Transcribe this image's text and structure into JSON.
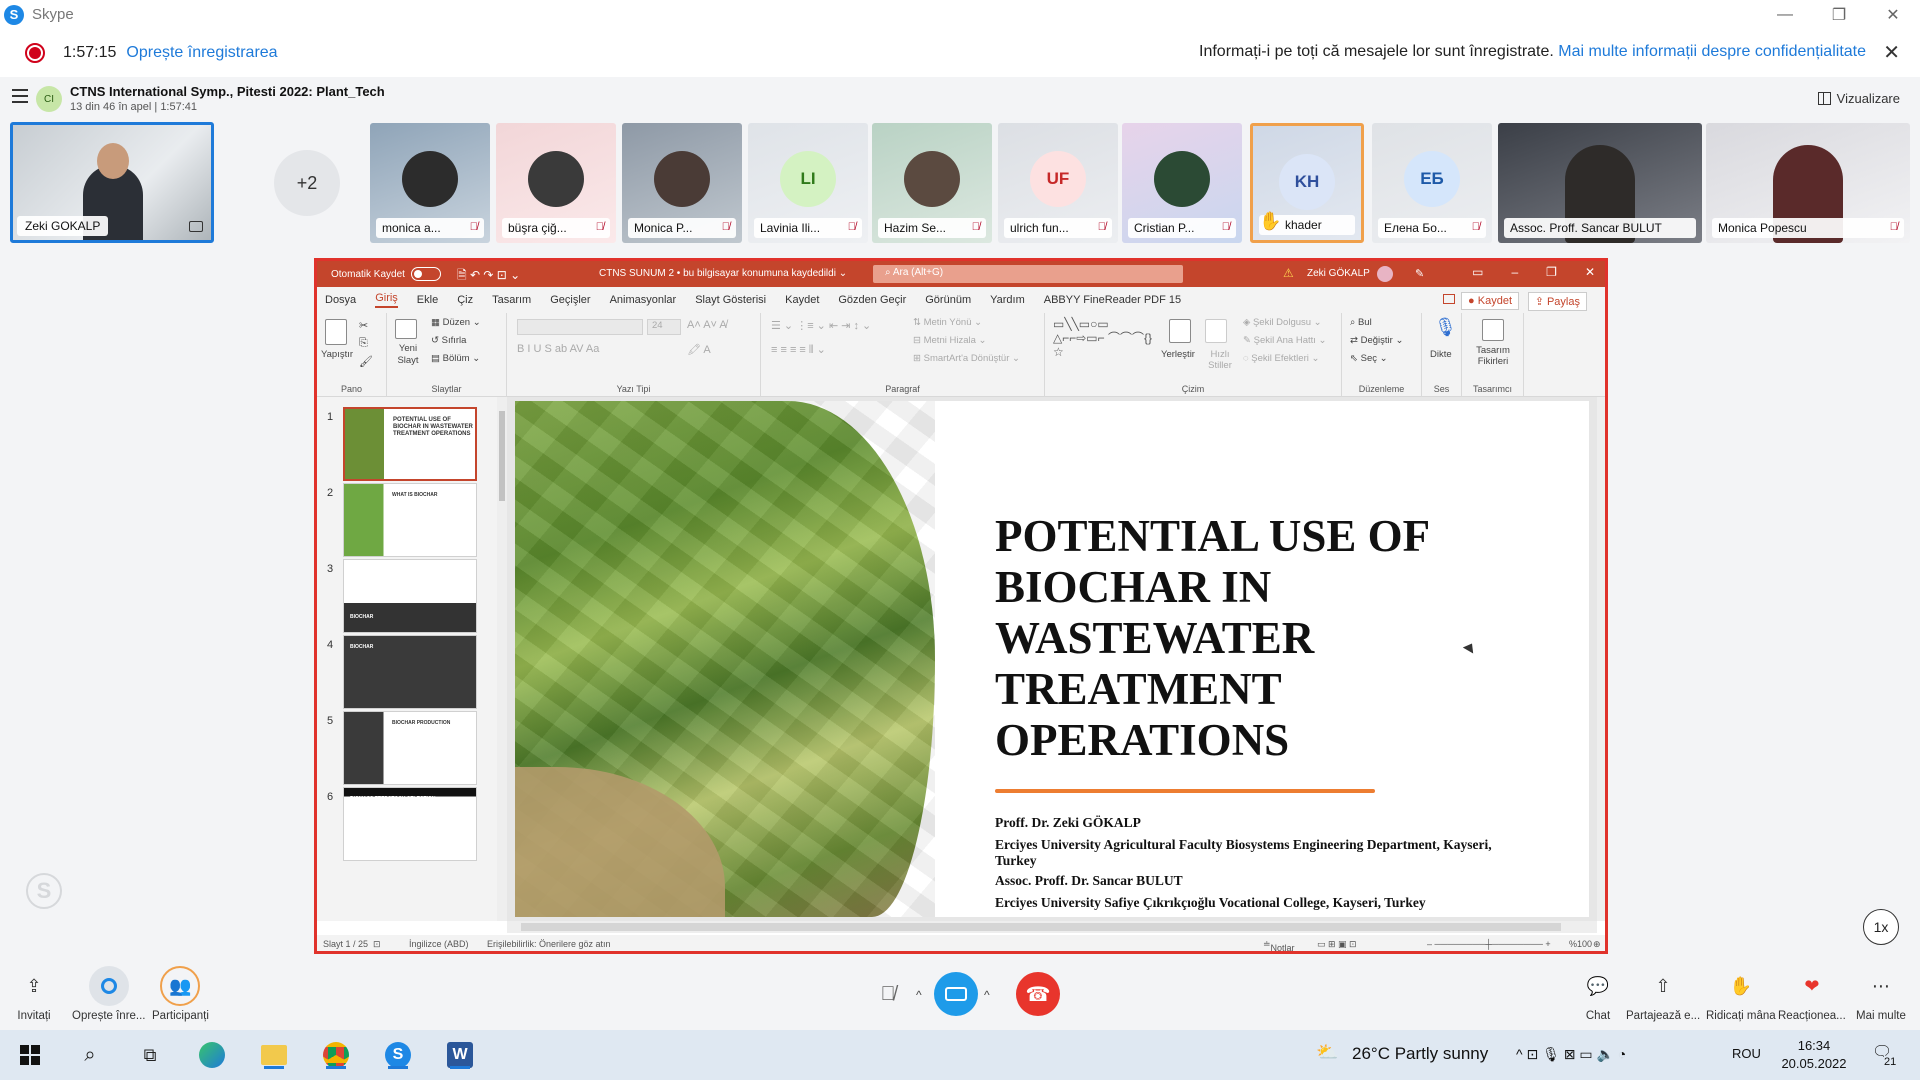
{
  "window": {
    "title": "Skype",
    "minimize": "—",
    "restore": "❐",
    "close": "✕"
  },
  "recording": {
    "time": "1:57:15",
    "stop_label": "Oprește înregistrarea",
    "notice": "Informați-i pe toți că mesajele lor sunt înregistrate.",
    "privacy_link": "Mai multe informații despre confidențialitate"
  },
  "call": {
    "group_initials": "CI",
    "title": "CTNS International Symp., Pitesti 2022: Plant_Tech",
    "subtitle": "13 din 46 în apel | 1:57:41",
    "layout_label": "Vizualizare"
  },
  "self_tile": {
    "name": "Zeki GOKALP"
  },
  "more_participants": "+2",
  "participants": [
    {
      "name": "monica a...",
      "initials": "",
      "muted": true
    },
    {
      "name": "büşra çiğ...",
      "initials": "",
      "muted": true
    },
    {
      "name": "Monica P...",
      "initials": "",
      "muted": true
    },
    {
      "name": "Lavinia Ili...",
      "initials": "LI",
      "muted": true
    },
    {
      "name": "Hazim Se...",
      "initials": "",
      "muted": true
    },
    {
      "name": "ulrich fun...",
      "initials": "UF",
      "muted": true
    },
    {
      "name": "Cristian P...",
      "initials": "",
      "muted": true
    },
    {
      "name": "khader",
      "initials": "KH",
      "muted": false,
      "hand": "✋"
    },
    {
      "name": "Елена Бо...",
      "initials": "ЕБ",
      "muted": true
    },
    {
      "name": "Assoc. Proff. Sancar BULUT",
      "initials": "",
      "muted": false
    },
    {
      "name": "Monica Popescu",
      "initials": "",
      "muted": true
    }
  ],
  "ppt": {
    "autosave": "Otomatik Kaydet",
    "doc_title": "CTNS SUNUM 2 • bu bilgisayar konumuna kaydedildi ⌄",
    "search_placeholder": "Ara (Alt+G)",
    "user": "Zeki GÖKALP",
    "tabs": [
      "Dosya",
      "Giriş",
      "Ekle",
      "Çiz",
      "Tasarım",
      "Geçişler",
      "Animasyonlar",
      "Slayt Gösterisi",
      "Kaydet",
      "Gözden Geçir",
      "Görünüm",
      "Yardım",
      "ABBYY FineReader PDF 15"
    ],
    "save_btn": "Kaydet",
    "share_btn": "Paylaş",
    "ribbon": {
      "pano": "Pano",
      "yapistir": "Yapıştır",
      "yeni_slayt": "Yeni Slayt",
      "duzen": "Düzen",
      "sifirla": "Sıfırla",
      "bolum": "Bölüm",
      "slaytlar": "Slaytlar",
      "yazi_tipi": "Yazı Tipi",
      "font_size": "24",
      "paragraf": "Paragraf",
      "metin_yonu": "Metin Yönü",
      "metni_hizala": "Metni Hizala",
      "smartart": "SmartArt'a Dönüştür",
      "cizim": "Çizim",
      "yerlestir": "Yerleştir",
      "hizli_stiller": "Hızlı Stiller",
      "sekil_dolgusu": "Şekil Dolgusu",
      "sekil_ana_hatti": "Şekil Ana Hattı",
      "sekil_efektleri": "Şekil Efektleri",
      "bul": "Bul",
      "degistir": "Değiştir",
      "sec": "Seç",
      "duzenleme": "Düzenleme",
      "dikte": "Dikte",
      "ses": "Ses",
      "tasarim_fikirleri": "Tasarım Fikirleri",
      "tasarimci": "Tasarımcı"
    },
    "thumbnails": [
      {
        "num": "1",
        "text": "POTENTIAL USE OF BIOCHAR IN WASTEWATER TREATMENT OPERATIONS"
      },
      {
        "num": "2",
        "text": "WHAT IS BIOCHAR"
      },
      {
        "num": "3",
        "text": "BIOCHAR"
      },
      {
        "num": "4",
        "text": "BIOCHAR"
      },
      {
        "num": "5",
        "text": "BIOCHAR PRODUCTION"
      },
      {
        "num": "6",
        "text": "BIOMASS FEEDSTOCK SELECTION"
      }
    ],
    "slide": {
      "title": "POTENTIAL USE OF BIOCHAR IN WASTEWATER TREATMENT OPERATIONS",
      "author1": "Proff. Dr. Zeki GÖKALP",
      "affiliation1": "Erciyes University Agricultural Faculty Biosystems Engineering Department, Kayseri, Turkey",
      "author2": "Assoc. Proff. Dr. Sancar BULUT",
      "affiliation2": "Erciyes University Safiye Çıkrıkçıoğlu Vocational College, Kayseri, Turkey"
    },
    "status": {
      "slide": "Slayt 1 / 25",
      "language": "İngilizce (ABD)",
      "accessibility": "Erişilebilirlik: Önerilere göz atın",
      "notes": "Notlar",
      "zoom": "%100"
    }
  },
  "speed": "1x",
  "controls": {
    "invite": "Invitați",
    "stop_recording": "Oprește înre...",
    "participants": "Participanți",
    "chat": "Chat",
    "share": "Partajează e...",
    "raise_hand": "Ridicați mâna",
    "react": "Reacționea...",
    "more": "Mai multe"
  },
  "taskbar": {
    "weather": "26°C  Partly sunny",
    "language": "ROU",
    "time": "16:34",
    "date": "20.05.2022",
    "notifications": "21"
  }
}
